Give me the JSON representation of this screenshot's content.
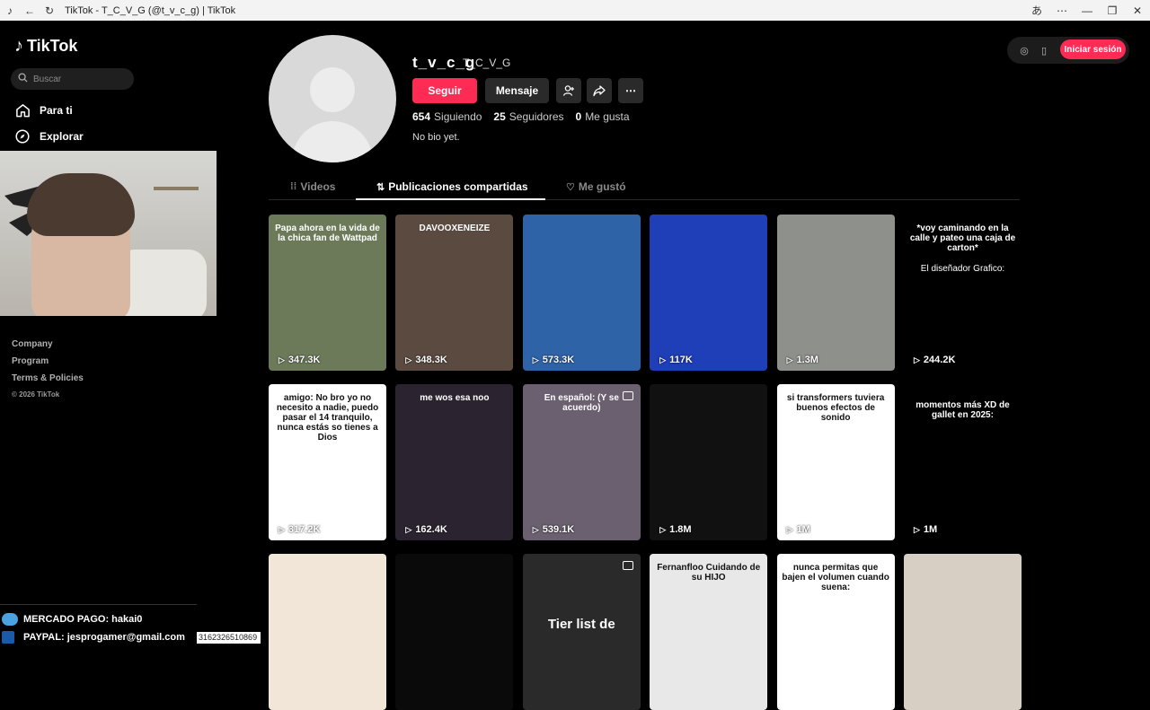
{
  "browser": {
    "title": "TikTok - T_C_V_G (@t_v_c_g) | TikTok"
  },
  "sidebar": {
    "logo": "TikTok",
    "search_placeholder": "Buscar",
    "nav": [
      {
        "label": "Para ti",
        "icon": "home-icon"
      },
      {
        "label": "Explorar",
        "icon": "compass-icon"
      }
    ],
    "footer": {
      "company": "Company",
      "program": "Program",
      "terms": "Terms & Policies",
      "copyright": "© 2026 TikTok"
    }
  },
  "overlay": {
    "mercado": "MERCADO PAGO: hakai0",
    "paypal": "PAYPAL: jesprogamer@gmail.com",
    "phone": "3162326510869"
  },
  "profile": {
    "username": "t_v_c_g",
    "nickname": "T_C_V_G",
    "follow_label": "Seguir",
    "message_label": "Mensaje",
    "following_count": "654",
    "following_label": "Siguiendo",
    "followers_count": "25",
    "followers_label": "Seguidores",
    "likes_count": "0",
    "likes_label": "Me gusta",
    "bio": "No bio yet."
  },
  "tabs": [
    {
      "label": "Videos",
      "icon": "grid-icon"
    },
    {
      "label": "Publicaciones compartidas",
      "icon": "repost-icon",
      "active": true
    },
    {
      "label": "Me gustó",
      "icon": "heart-icon"
    }
  ],
  "header_right": {
    "login_label": "Iniciar sesión"
  },
  "videos": [
    {
      "views": "347.3K",
      "caption": "Papa ahora en la vida de la chica fan de Wattpad",
      "bg": "#6c7a5a"
    },
    {
      "views": "348.3K",
      "caption": "DAVOOXENEIZE",
      "bg": "#5a4a40"
    },
    {
      "views": "573.3K",
      "caption": "",
      "bg": "#2f63a8"
    },
    {
      "views": "117K",
      "caption": "",
      "bg": "#1f3fb8"
    },
    {
      "views": "1.3M",
      "caption": "",
      "bg": "#8e908c"
    },
    {
      "views": "244.2K",
      "caption": "*voy caminando en la calle y pateo una caja de carton*",
      "caption2": "El diseñador Grafico:",
      "bg": "#000000"
    },
    {
      "views": "317.2K",
      "caption": "amigo: No bro yo no necesito a nadie, puedo pasar el 14 tranquilo, nunca estás so tienes a Dios",
      "bg": "#ffffff"
    },
    {
      "views": "162.4K",
      "caption": "me wos esa noo",
      "bg": "#2b2430"
    },
    {
      "views": "539.1K",
      "caption": "En español: (Y se acuerdo)",
      "bg": "#6a6070"
    },
    {
      "views": "1.8M",
      "caption": "",
      "bg": "#111111"
    },
    {
      "views": "1M",
      "caption": "si transformers tuviera buenos efectos de sonido",
      "bg": "#ffffff"
    },
    {
      "views": "1M",
      "caption": "momentos más XD de gallet en 2025:",
      "bg": "#000000"
    },
    {
      "views": "",
      "caption": "",
      "bg": "#f1e6d8"
    },
    {
      "views": "",
      "caption": "",
      "bg": "#0a0a0a"
    },
    {
      "views": "",
      "caption": "Tier list de",
      "bg": "#2a2a2a"
    },
    {
      "views": "",
      "caption": "Fernanfloo Cuidando de su HIJO",
      "bg": "#e8e8e8"
    },
    {
      "views": "",
      "caption": "nunca permitas que bajen el volumen cuando suena:",
      "bg": "#ffffff"
    },
    {
      "views": "",
      "caption": "",
      "bg": "#d8cfc4"
    }
  ],
  "colors": {
    "accent": "#fe2c55",
    "background": "#000000",
    "surface": "#2a2a2a"
  }
}
